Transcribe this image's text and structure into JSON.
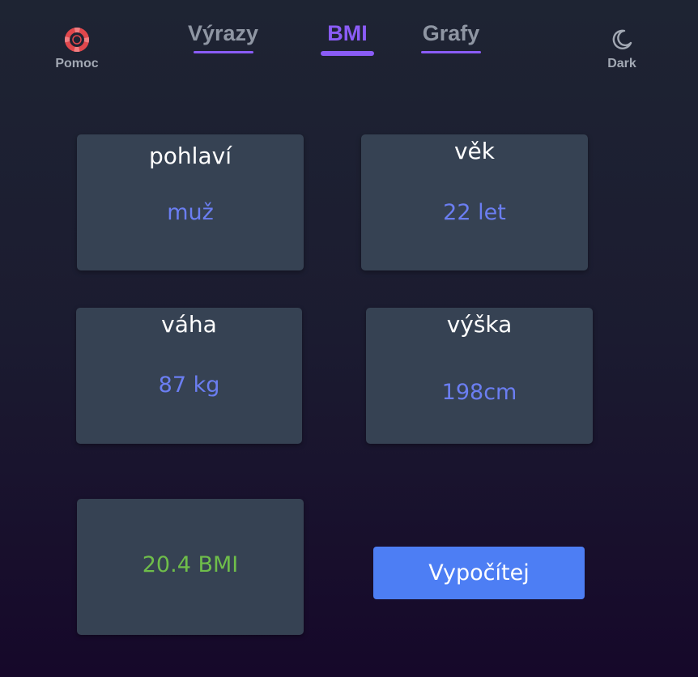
{
  "header": {
    "help_label": "Pomoc",
    "theme_label": "Dark",
    "tabs": [
      {
        "label": "Výrazy",
        "active": false
      },
      {
        "label": "BMI",
        "active": true
      },
      {
        "label": "Grafy",
        "active": false
      }
    ]
  },
  "form": {
    "gender": {
      "label": "pohlaví",
      "value": "muž"
    },
    "age": {
      "label": "věk",
      "value": "22 let"
    },
    "weight": {
      "label": "váha",
      "value": "87 kg"
    },
    "height": {
      "label": "výška",
      "value": "198cm"
    }
  },
  "result": {
    "value": "20.4 BMI"
  },
  "calculate_label": "Vypočítej",
  "icons": {
    "help": "lifebuoy-icon",
    "theme": "moon-icon"
  },
  "colors": {
    "accent": "#8b5cf6",
    "value": "#6b7ef2",
    "result": "#6fbe4a",
    "button": "#4d7ef4",
    "card": "#364253",
    "help_icon": "#e0474c"
  }
}
